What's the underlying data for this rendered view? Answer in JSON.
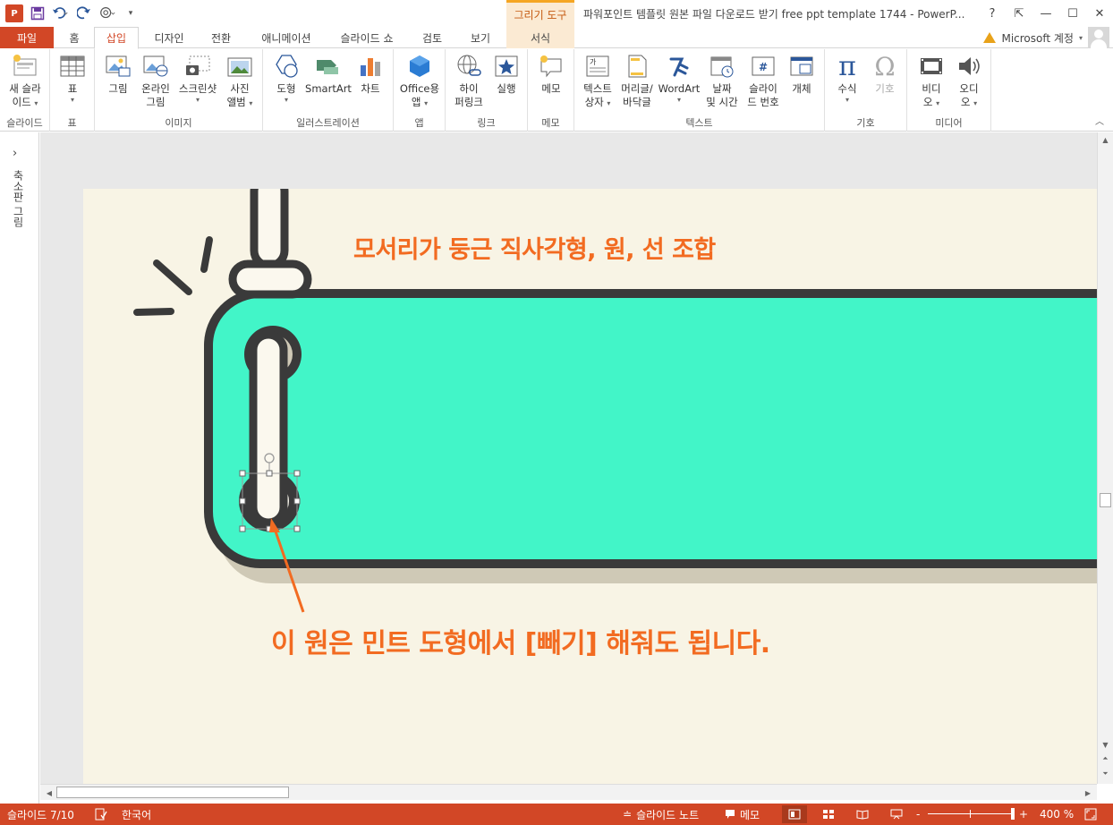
{
  "window": {
    "title": "파워포인트 템플릿 원본 파일 다운로드 받기 free ppt template 1744 - PowerP...",
    "context_tab_group": "그리기 도구",
    "app_icon": "P",
    "controls": [
      "?",
      "⇱",
      "—",
      "☐",
      "✕"
    ]
  },
  "quick_access": [
    "save-icon",
    "undo-icon",
    "redo-icon",
    "touch-mode-icon",
    "customize-icon"
  ],
  "tabs": [
    {
      "label": "파일"
    },
    {
      "label": "홈"
    },
    {
      "label": "삽입"
    },
    {
      "label": "디자인"
    },
    {
      "label": "전환"
    },
    {
      "label": "애니메이션"
    },
    {
      "label": "슬라이드 쇼"
    },
    {
      "label": "검토"
    },
    {
      "label": "보기"
    },
    {
      "label": "서식"
    }
  ],
  "account": {
    "label": "Microsoft 계정"
  },
  "ribbon": {
    "groups": [
      {
        "label": "슬라이드",
        "buttons": [
          {
            "line1": "새 슬라",
            "line2": "이드"
          }
        ]
      },
      {
        "label": "표",
        "buttons": [
          {
            "line1": "표",
            "line2": ""
          }
        ]
      },
      {
        "label": "이미지",
        "buttons": [
          {
            "line1": "그림",
            "line2": ""
          },
          {
            "line1": "온라인",
            "line2": "그림"
          },
          {
            "line1": "스크린샷",
            "line2": ""
          },
          {
            "line1": "사진",
            "line2": "앨범"
          }
        ]
      },
      {
        "label": "일러스트레이션",
        "buttons": [
          {
            "line1": "도형",
            "line2": ""
          },
          {
            "line1": "SmartArt",
            "line2": ""
          },
          {
            "line1": "차트",
            "line2": ""
          }
        ]
      },
      {
        "label": "앱",
        "buttons": [
          {
            "line1": "Office용",
            "line2": "앱"
          }
        ]
      },
      {
        "label": "링크",
        "buttons": [
          {
            "line1": "하이",
            "line2": "퍼링크"
          },
          {
            "line1": "실행",
            "line2": ""
          }
        ]
      },
      {
        "label": "메모",
        "buttons": [
          {
            "line1": "메모",
            "line2": ""
          }
        ]
      },
      {
        "label": "텍스트",
        "buttons": [
          {
            "line1": "텍스트",
            "line2": "상자"
          },
          {
            "line1": "머리글/",
            "line2": "바닥글"
          },
          {
            "line1": "WordArt",
            "line2": ""
          },
          {
            "line1": "날짜",
            "line2": "및 시간"
          },
          {
            "line1": "슬라이",
            "line2": "드 번호"
          },
          {
            "line1": "개체",
            "line2": ""
          }
        ]
      },
      {
        "label": "기호",
        "buttons": [
          {
            "line1": "수식",
            "line2": ""
          },
          {
            "line1": "기호",
            "line2": ""
          }
        ]
      },
      {
        "label": "미디어",
        "buttons": [
          {
            "line1": "비디",
            "line2": "오"
          },
          {
            "line1": "오디",
            "line2": "오"
          }
        ]
      }
    ]
  },
  "thumbnail_pane": {
    "label": "축소판 그림",
    "expand": "›"
  },
  "slide": {
    "heading": "모서리가 둥근 직사각형, 원, 선 조합",
    "annotation": "이 원은 민트 도형에서 [빼기] 해줘도 됩니다.",
    "colors": {
      "background": "#f8f4e5",
      "mint": "#42f5c8",
      "outline": "#3a3a3a",
      "accent": "#f26b21",
      "shadow": "#cfc9b6",
      "cream": "#fbf8ee"
    }
  },
  "status": {
    "slide_counter": "슬라이드 7/10",
    "language": "한국어",
    "notes": "슬라이드 노트",
    "comments": "메모",
    "zoom": "400 %",
    "zoom_level_fraction": 0.97,
    "minus": "-",
    "plus": "+"
  }
}
